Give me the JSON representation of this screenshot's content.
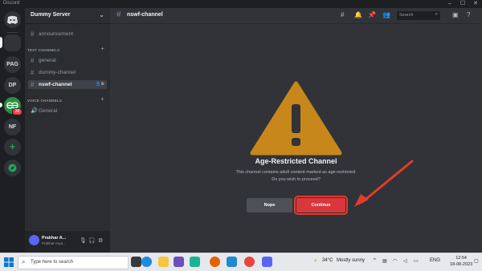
{
  "window": {
    "app_name": "Discord",
    "minimize": "–",
    "maximize": "☐",
    "close": "✕"
  },
  "guilds": [
    {
      "label": "PAG"
    },
    {
      "label": "DP"
    },
    {
      "label": "GfG",
      "badge": "28"
    },
    {
      "label": "NF"
    }
  ],
  "server": {
    "name": "Dummy Server",
    "categories": {
      "text": "TEXT CHANNELS",
      "voice": "VOICE CHANNELS"
    },
    "channels": {
      "announcement": "announcement",
      "general": "general",
      "dummy": "dummy-channel",
      "nsfw": "nswf-channel",
      "voice_general": "General"
    }
  },
  "user": {
    "name": "Prakhar A...",
    "sub": "Prakhar Arya..."
  },
  "topbar": {
    "channel": "nswf-channel",
    "search_placeholder": "Search"
  },
  "gate": {
    "title": "Age-Restricted Channel",
    "line1": "This channel contains adult content marked as age-restricted.",
    "line2": "Do you wish to proceed?",
    "nope": "Nope",
    "continue": "Continue"
  },
  "colors": {
    "warning": "#c7871a",
    "continue": "#da373c",
    "annotation_arrow": "#e33b2e"
  },
  "taskbar": {
    "search_placeholder": "Type here to search",
    "weather_temp": "34°C",
    "weather_text": "Mostly sunny",
    "lang": "ENG",
    "time": "12:54",
    "date": "18-08-2023"
  }
}
